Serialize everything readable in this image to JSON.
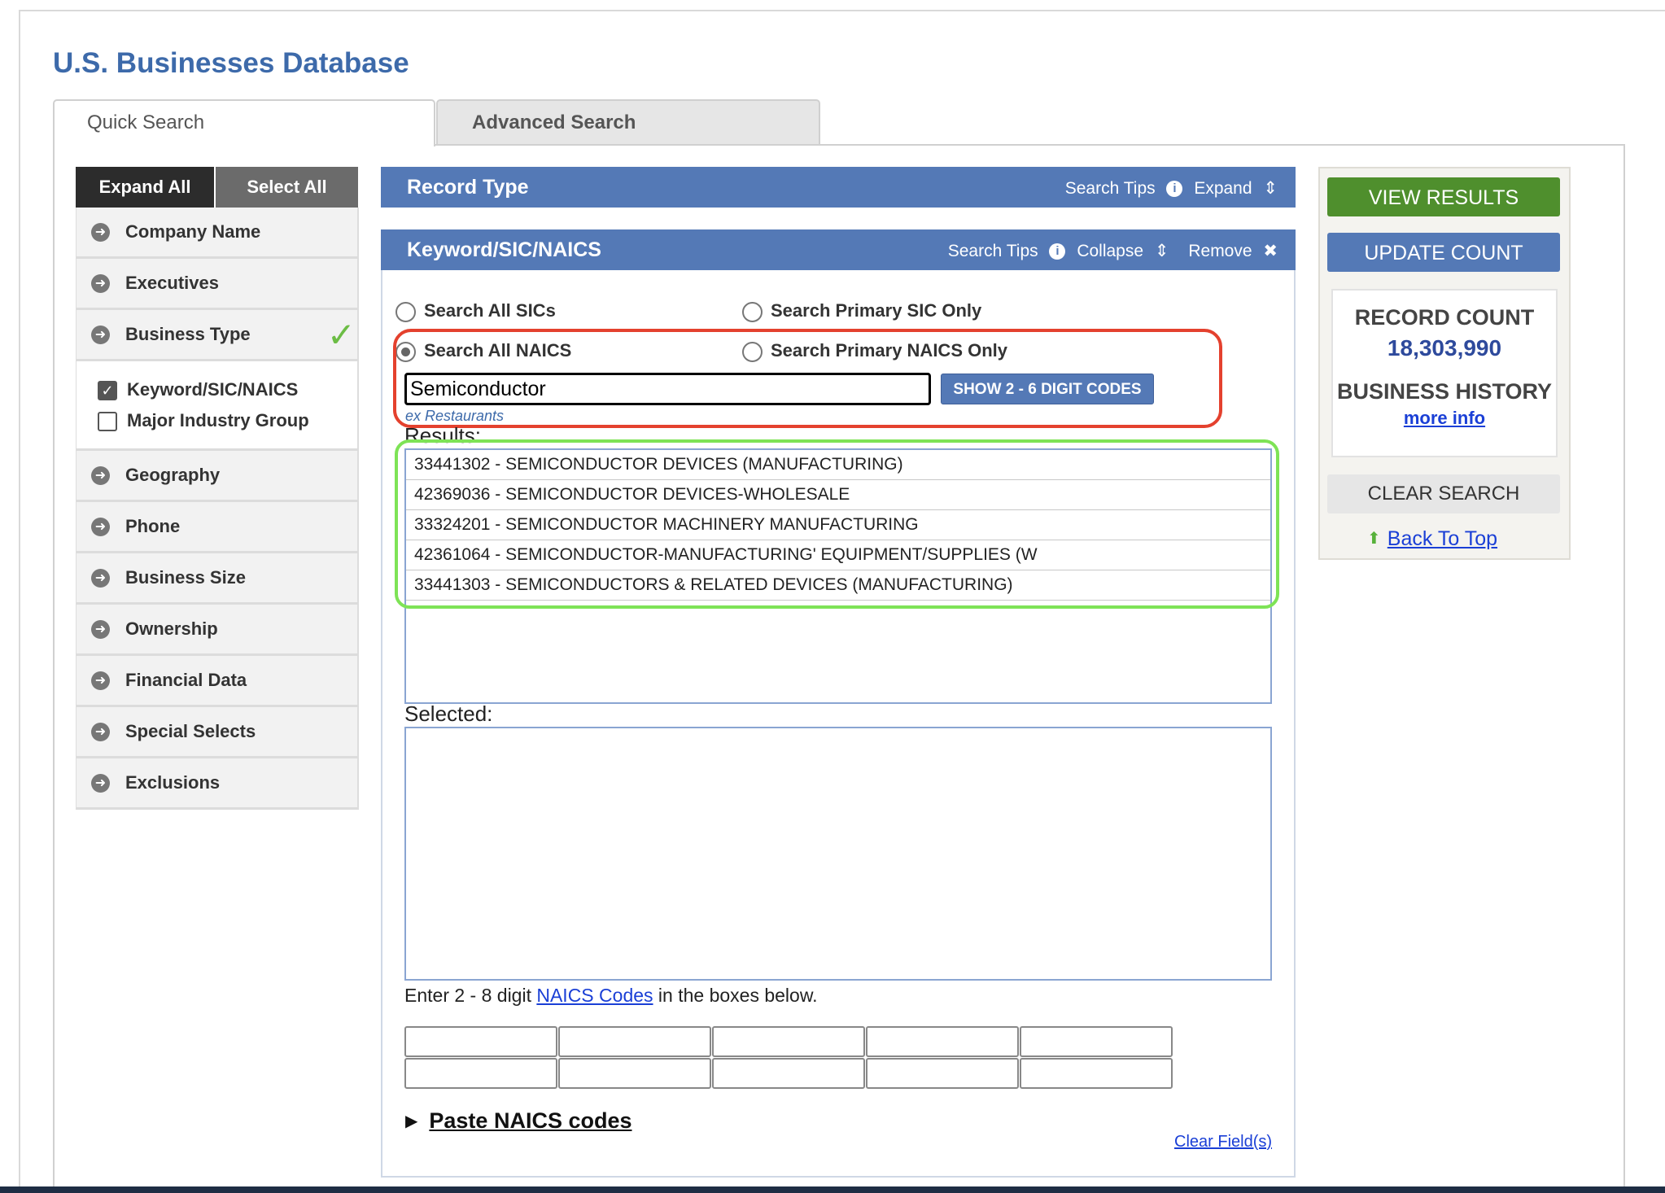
{
  "page": {
    "title": "U.S. Businesses Database"
  },
  "tabs": {
    "quick": "Quick Search",
    "advanced": "Advanced Search"
  },
  "sidebar": {
    "expand_all": "Expand All",
    "select_all": "Select All",
    "items": [
      {
        "label": "Company Name"
      },
      {
        "label": "Executives"
      },
      {
        "label": "Business Type",
        "checked": true
      },
      {
        "label": "Geography"
      },
      {
        "label": "Phone"
      },
      {
        "label": "Business Size"
      },
      {
        "label": "Ownership"
      },
      {
        "label": "Financial Data"
      },
      {
        "label": "Special Selects"
      },
      {
        "label": "Exclusions"
      }
    ],
    "business_type_sub": [
      {
        "label": "Keyword/SIC/NAICS",
        "checked": true
      },
      {
        "label": "Major Industry Group",
        "checked": false
      }
    ]
  },
  "record_type": {
    "title": "Record Type",
    "search_tips": "Search Tips",
    "expand": "Expand"
  },
  "keyword": {
    "title": "Keyword/SIC/NAICS",
    "search_tips": "Search Tips",
    "collapse": "Collapse",
    "remove": "Remove",
    "radio_all_sics": "Search All SICs",
    "radio_primary_sic": "Search Primary SIC Only",
    "radio_all_naics": "Search All NAICS",
    "radio_primary_naics": "Search Primary NAICS Only",
    "selected_radio": "Search All NAICS",
    "search_value": "Semiconductor",
    "show_codes_button": "SHOW 2 - 6 DIGIT CODES",
    "example": "ex Restaurants",
    "results_label": "Results:",
    "results": [
      "33441302 - SEMICONDUCTOR DEVICES (MANUFACTURING)",
      "42369036 - SEMICONDUCTOR DEVICES-WHOLESALE",
      "33324201 - SEMICONDUCTOR MACHINERY MANUFACTURING",
      "42361064 - SEMICONDUCTOR-MANUFACTURING' EQUIPMENT/SUPPLIES (W",
      "33441303 - SEMICONDUCTORS & RELATED DEVICES (MANUFACTURING)"
    ],
    "selected_label": "Selected:",
    "enter_prefix": "Enter 2 - 8 digit ",
    "enter_link": "NAICS Codes",
    "enter_suffix": " in the boxes below.",
    "paste_label": "Paste NAICS codes",
    "clear_fields": "Clear Field(s)"
  },
  "right_panel": {
    "view_results": "VIEW RESULTS",
    "update_count": "UPDATE COUNT",
    "record_count_label": "RECORD COUNT",
    "record_count_value": "18,303,990",
    "business_history_label": "BUSINESS HISTORY",
    "more_info": "more info",
    "clear_search": "CLEAR SEARCH",
    "back_to_top": "Back To Top"
  },
  "colors": {
    "header_blue": "#5479b6",
    "view_green": "#4f8f2d",
    "highlight_red": "#e4412e",
    "highlight_green": "#7ee356",
    "check_green": "#6cbd45"
  }
}
